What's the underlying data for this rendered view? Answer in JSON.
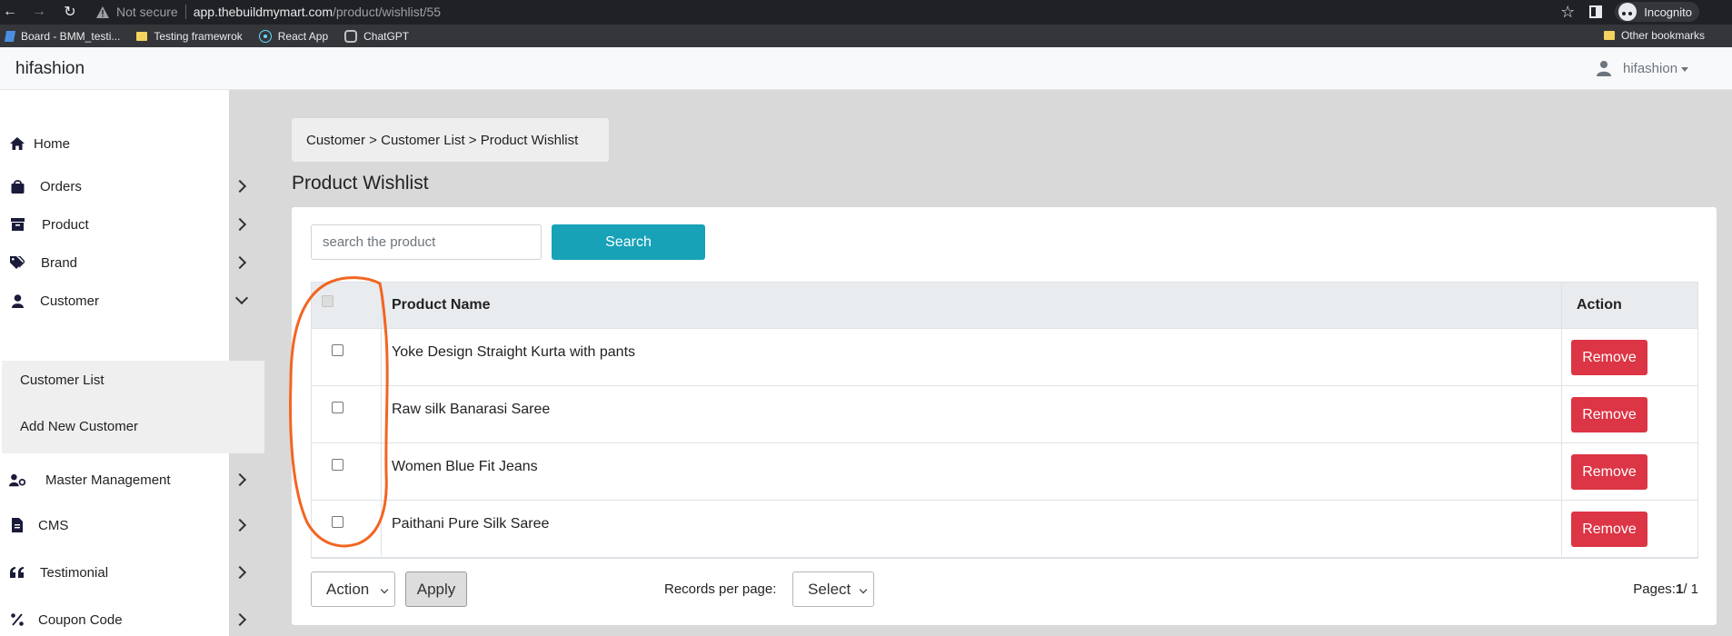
{
  "browser": {
    "security_label": "Not secure",
    "url_host": "app.thebuildmymart.com",
    "url_path": "/product/wishlist/55",
    "incognito_label": "Incognito",
    "bookmarks": [
      "Board - BMM_testi...",
      "Testing framewrok",
      "React App",
      "ChatGPT"
    ],
    "other_bookmarks": "Other bookmarks"
  },
  "header": {
    "brand": "hifashion",
    "user": "hifashion"
  },
  "sidebar": {
    "items": [
      {
        "label": "Home",
        "icon": "home-icon"
      },
      {
        "label": "Orders",
        "icon": "shopping-bag-icon"
      },
      {
        "label": "Product",
        "icon": "archive-box-icon"
      },
      {
        "label": "Brand",
        "icon": "tags-icon"
      },
      {
        "label": "Customer",
        "icon": "user-icon"
      },
      {
        "label": "Master Management",
        "icon": "user-gear-icon"
      },
      {
        "label": "CMS",
        "icon": "file-icon"
      },
      {
        "label": "Testimonial",
        "icon": "quote-icon"
      },
      {
        "label": "Coupon Code",
        "icon": "percent-icon"
      }
    ],
    "customer_submenu": [
      "Customer List",
      "Add New Customer"
    ]
  },
  "main": {
    "breadcrumb": "Customer > Customer List > Product Wishlist",
    "title": "Product Wishlist",
    "search_placeholder": "search the product",
    "search_button": "Search",
    "columns": {
      "product_name": "Product Name",
      "action": "Action"
    },
    "rows": [
      {
        "product": "Yoke Design Straight Kurta with pants",
        "action": "Remove"
      },
      {
        "product": "Raw silk Banarasi Saree",
        "action": "Remove"
      },
      {
        "product": "Women Blue Fit Jeans",
        "action": "Remove"
      },
      {
        "product": "Paithani Pure Silk Saree",
        "action": "Remove"
      }
    ],
    "bulk_action": "Action",
    "apply_button": "Apply",
    "records_label": "Records per page:",
    "records_select": "Select",
    "pages_label": "Pages:",
    "current_page": "1",
    "total_pages": "/ 1"
  },
  "colors": {
    "search_button": "#17a2b8",
    "remove_button": "#dc3545",
    "annotation": "#f26522"
  }
}
